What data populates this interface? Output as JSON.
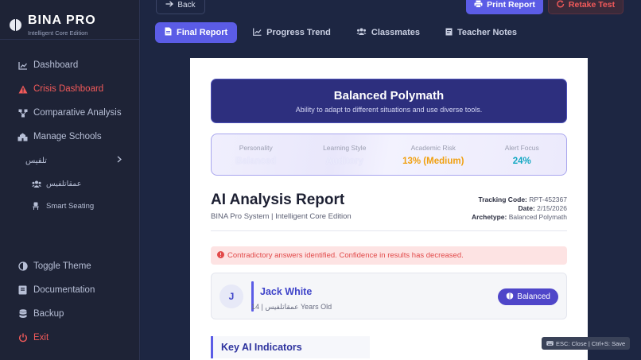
{
  "brand": {
    "title": "BINA PRO",
    "subtitle": "Intelligent Core Edition"
  },
  "sidebar": {
    "items": [
      {
        "label": "Dashboard",
        "icon": "chart-line-icon"
      },
      {
        "label": "Crisis Dashboard",
        "icon": "warning-icon",
        "color": "#f25a5a"
      },
      {
        "label": "Comparative Analysis",
        "icon": "network-icon"
      },
      {
        "label": "Manage Schools",
        "icon": "school-icon"
      }
    ],
    "group": {
      "label": "تلفيس",
      "icon": "chevron-right-icon"
    },
    "subitems": [
      {
        "label": "عمقاتلفيس",
        "icon": "users-icon"
      },
      {
        "label": "Smart Seating",
        "icon": "chair-icon"
      }
    ],
    "bottom": [
      {
        "label": "Toggle Theme",
        "icon": "theme-icon"
      },
      {
        "label": "Documentation",
        "icon": "book-icon"
      },
      {
        "label": "Backup",
        "icon": "database-icon"
      },
      {
        "label": "Exit",
        "icon": "power-icon",
        "color": "#f25a5a"
      }
    ]
  },
  "toolbar": {
    "back_label": "Back",
    "print_label": "Print Report",
    "retake_label": "Retake Test"
  },
  "tabs": [
    {
      "label": "Final Report",
      "icon": "file-icon",
      "active": true
    },
    {
      "label": "Progress Trend",
      "icon": "chart-line-icon",
      "active": false
    },
    {
      "label": "Classmates",
      "icon": "users-icon",
      "active": false
    },
    {
      "label": "Teacher Notes",
      "icon": "note-icon",
      "active": false
    }
  ],
  "report": {
    "hero_title": "Balanced Polymath",
    "hero_subtitle": "Ability to adapt to different situations and use diverse tools.",
    "stats": [
      {
        "label": "Personality",
        "value": "Balanced"
      },
      {
        "label": "Learning Style",
        "value": "Auditory"
      },
      {
        "label": "Academic Risk",
        "value": "13% (Medium)"
      },
      {
        "label": "Alert Focus",
        "value": "24%"
      }
    ],
    "title": "AI Analysis Report",
    "subtitle": "BINA Pro System | Intelligent Core Edition",
    "meta": {
      "tracking_label": "Tracking Code:",
      "tracking_value": "RPT-452367",
      "date_label": "Date:",
      "date_value": "2/15/2026",
      "archetype_label": "Archetype:",
      "archetype_value": "Balanced Polymath"
    },
    "alert": "Contradictory answers identified. Confidence in results has decreased.",
    "student": {
      "initial": "J",
      "name": "Jack White",
      "meta": "14 | عمقاتلفيس Years Old",
      "badge": "Balanced"
    },
    "section_title": "Key AI Indicators"
  },
  "hint": "ESC: Close | Ctrl+S: Save",
  "colors": {
    "accent": "#5b5ce6",
    "danger": "#f25a5a",
    "warning": "#f0a011",
    "teal": "#12a7c2"
  }
}
